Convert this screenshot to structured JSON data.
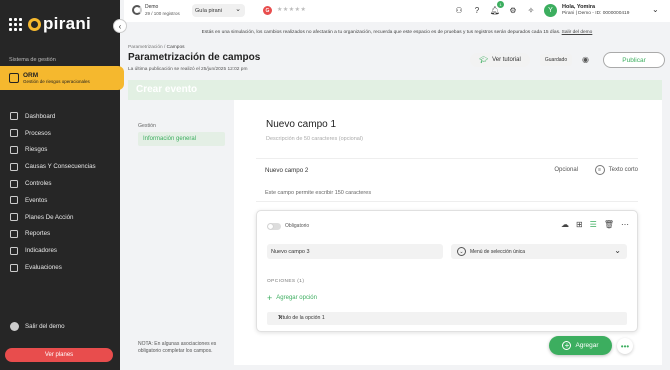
{
  "brand": {
    "name": "pirani"
  },
  "sidebar": {
    "section_label": "Sistema de gestión",
    "module": {
      "title": "ORM",
      "subtitle": "Gestión de riesgos operacionales"
    },
    "items": [
      {
        "label": "Dashboard",
        "icon": "monitor-icon"
      },
      {
        "label": "Procesos",
        "icon": "process-icon"
      },
      {
        "label": "Riesgos",
        "icon": "risk-icon"
      },
      {
        "label": "Causas Y Consecuencias",
        "icon": "causes-icon"
      },
      {
        "label": "Controles",
        "icon": "controls-icon"
      },
      {
        "label": "Eventos",
        "icon": "warning-icon"
      },
      {
        "label": "Planes De Acción",
        "icon": "plans-icon"
      },
      {
        "label": "Reportes",
        "icon": "report-icon"
      },
      {
        "label": "Indicadores",
        "icon": "indicator-icon"
      },
      {
        "label": "Evaluaciones",
        "icon": "evaluation-icon"
      }
    ],
    "exit_label": "Salir del demo",
    "plans_button": "Ver planes"
  },
  "topbar": {
    "demo_name": "Demo",
    "demo_records": "29 / 100 registros",
    "guide_label": "Guía pirani",
    "g_badge": "G",
    "stars": "★★★★★",
    "notification_count": "1",
    "avatar_letter": "Y",
    "greeting": "Hola, Yomira",
    "user_sub": "Pirani | Demo - ID: 0000000419"
  },
  "banner": {
    "text": "Estás en una simulación, los cambios realizados no afectarán a tu organización, recuerda que este espacio es de pruebas y tus registros serán depurados cada 15 días.",
    "link": "Salir del demo"
  },
  "header": {
    "breadcrumb_parent": "Parametrización",
    "breadcrumb_sep": " / ",
    "breadcrumb_current": "Campos",
    "title": "Parametrización de campos",
    "publication": "La última publicación se realizó el 25/jun/2025 12:02 pm",
    "tutorial_label": "Ver tutorial",
    "saved_label": "Guardado",
    "publish_label": "Publicar"
  },
  "event_bar": {
    "title": "Crear evento"
  },
  "left_panel": {
    "section": "Gestión",
    "active_item": "Información general",
    "note": "NOTA: En algunas asociaciones es obligatorio completar los campos."
  },
  "form": {
    "field1": {
      "title": "Nuevo campo 1",
      "description": "Descripción de 50 caracteres (opcional)"
    },
    "field2": {
      "name": "Nuevo campo 2",
      "optional": "Opcional",
      "type": "Texto corto",
      "help": "Este campo permite escribir 150 caracteres"
    },
    "field3": {
      "required_label": "Obligatorio",
      "name_value": "Nuevo campo 3",
      "type_value": "Menú de selección única",
      "options_label": "OPCIONES (1)",
      "add_option": "Agregar opción",
      "option1": "Título de la opción 1"
    },
    "add_button": "Agregar",
    "more_button": "•••"
  },
  "colors": {
    "accent": "#3cae5f",
    "brand": "#f5b82e",
    "danger": "#e84d4d",
    "sidebar": "#262626"
  }
}
